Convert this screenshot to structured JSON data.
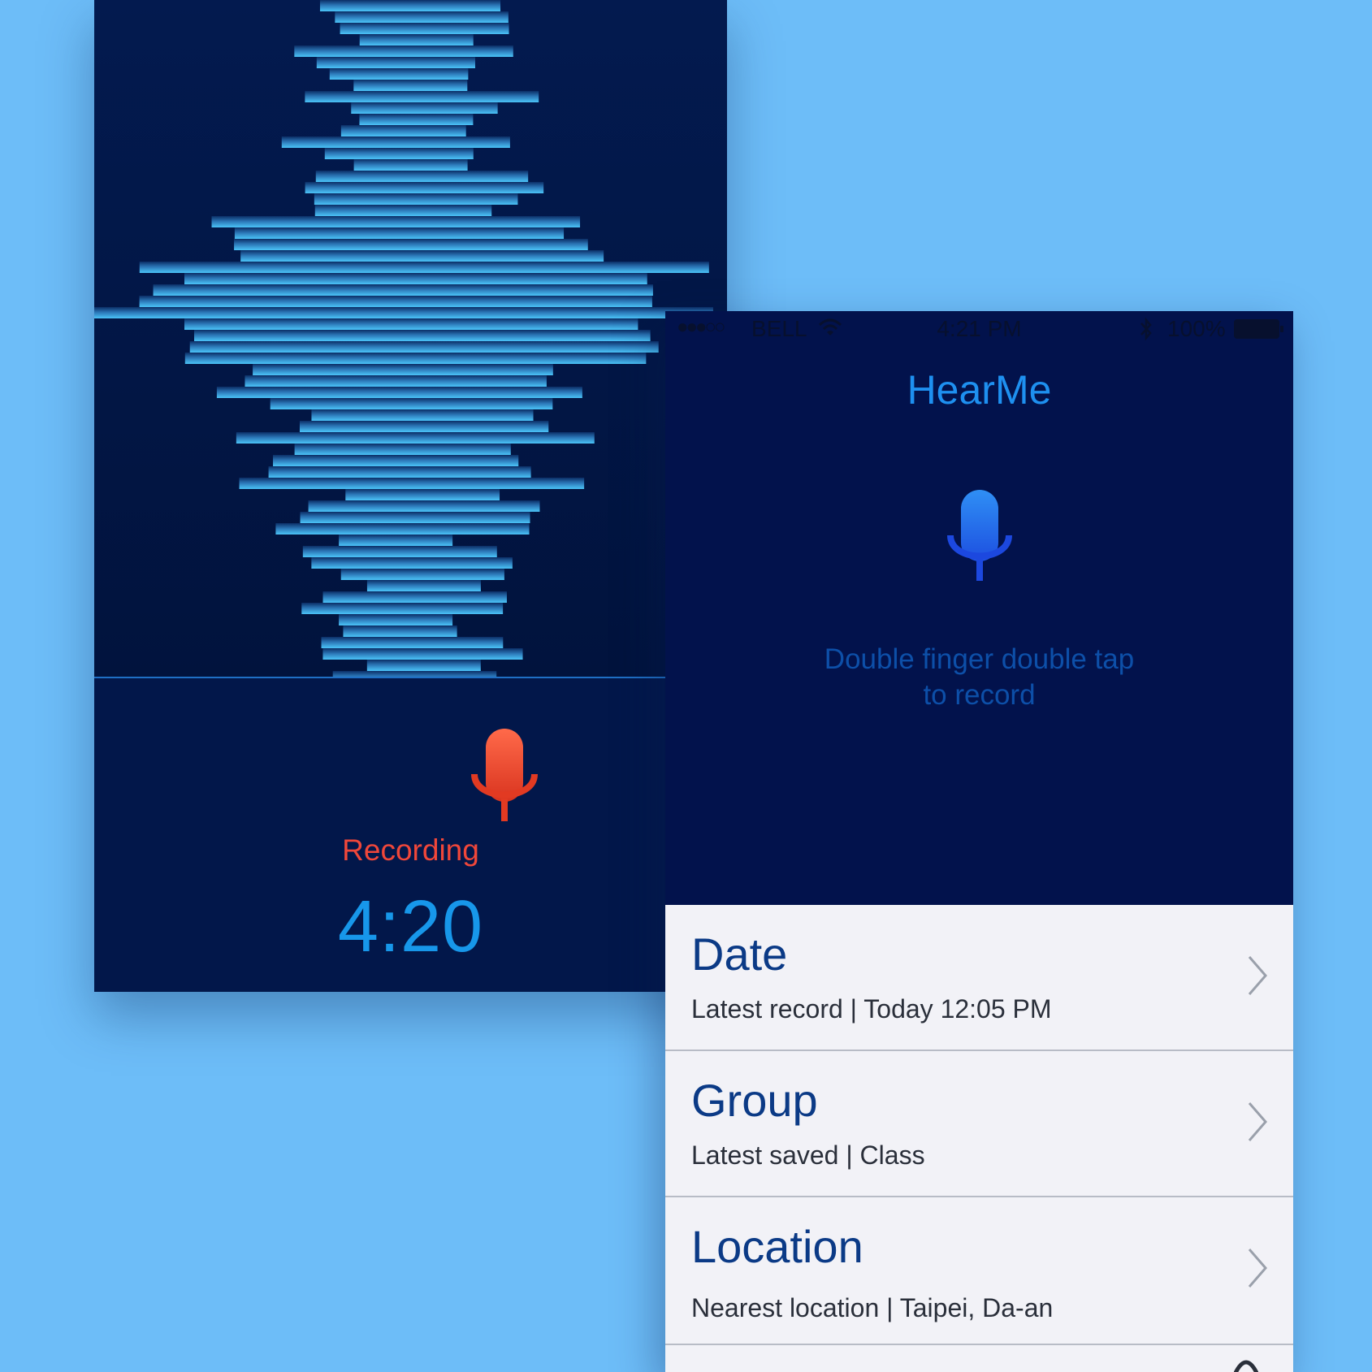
{
  "recording": {
    "label": "Recording",
    "timer": "4:20",
    "mic_icon": "microphone-icon",
    "mic_color": "#e8412b"
  },
  "status_bar": {
    "signal": "●●●○○",
    "carrier": "BELL",
    "time": "4:21 PM",
    "battery": "100%"
  },
  "home": {
    "title": "HearMe",
    "hint_line1": "Double finger double tap",
    "hint_line2": "to record",
    "mic_icon": "microphone-icon",
    "accent_color": "#1e90f0"
  },
  "list": {
    "items": [
      {
        "title": "Date",
        "subtitle": "Latest record | Today 12:05 PM"
      },
      {
        "title": "Group",
        "subtitle": "Latest saved | Class"
      },
      {
        "title": "Location",
        "subtitle": "Nearest location | Taipei, Da-an"
      }
    ]
  }
}
